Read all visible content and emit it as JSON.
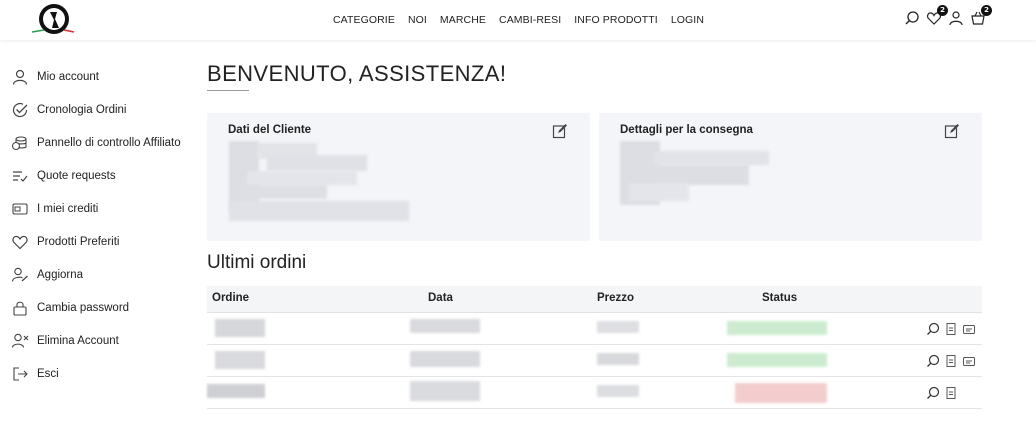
{
  "header": {
    "nav": [
      "CATEGORIE",
      "NOI",
      "MARCHE",
      "CAMBI-RESI",
      "INFO PRODOTTI",
      "LOGIN"
    ],
    "wishlist_count": "2",
    "cart_count": "2"
  },
  "sidebar": {
    "items": [
      {
        "label": "Mio account",
        "icon": "user-icon"
      },
      {
        "label": "Cronologia Ordini",
        "icon": "check-circle-icon"
      },
      {
        "label": "Pannello di controllo Affiliato",
        "icon": "coins-icon"
      },
      {
        "label": "Quote requests",
        "icon": "list-check-icon"
      },
      {
        "label": "I miei crediti",
        "icon": "wallet-icon"
      },
      {
        "label": "Prodotti Preferiti",
        "icon": "heart-icon"
      },
      {
        "label": "Aggiorna",
        "icon": "user-edit-icon"
      },
      {
        "label": "Cambia password",
        "icon": "lock-icon"
      },
      {
        "label": "Elimina Account",
        "icon": "user-remove-icon"
      },
      {
        "label": "Esci",
        "icon": "logout-icon"
      }
    ]
  },
  "main": {
    "title": "BENVENUTO, ASSISTENZA!",
    "card_customer_title": "Dati del Cliente",
    "card_delivery_title": "Dettagli per la consegna",
    "orders_title": "Ultimi ordini",
    "table_headers": [
      "Ordine",
      "Data",
      "Prezzo",
      "Status"
    ],
    "status_colors": [
      "#cdeccf",
      "#cdeccf",
      "#f3cdcd"
    ]
  }
}
